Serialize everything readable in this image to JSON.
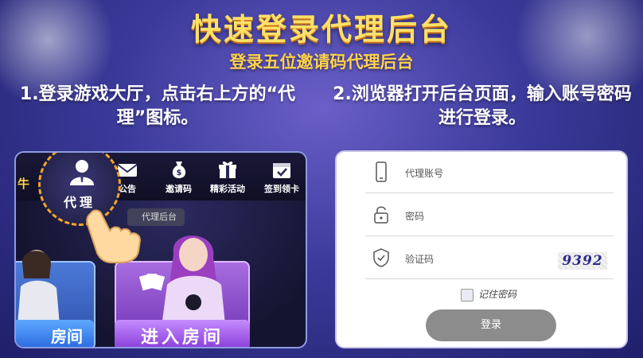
{
  "header": {
    "title": "快速登录代理后台",
    "subtitle": "登录五位邀请码代理后台"
  },
  "steps": {
    "step1": "1.登录游戏大厅，点击右上方的“代理”图标。",
    "step2": "2.浏览器打开后台页面，输入账号密码进行登录。"
  },
  "lobby": {
    "agent_label": "代理",
    "menu": {
      "notice": "公告",
      "invite": "邀请码",
      "events": "精彩活动",
      "checkin": "签到领卡"
    },
    "tooltip": "代理后台",
    "enter_room_left": "房间",
    "enter_room_right": "进入房间",
    "edge_char": "牛"
  },
  "login": {
    "account_placeholder": "代理账号",
    "password_placeholder": "密码",
    "captcha_placeholder": "验证码",
    "captcha_value": "9392",
    "remember_label": "记住密码",
    "submit_label": "登录"
  },
  "colors": {
    "title": "#ffe067",
    "subtitle": "#ffd24a",
    "agent_ring": "#f5a623",
    "login_button": "#8c8c8c"
  }
}
